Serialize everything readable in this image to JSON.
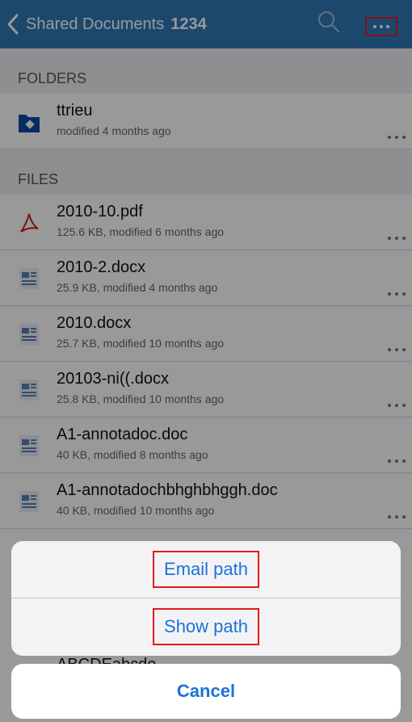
{
  "navbar": {
    "title": "Shared Documents",
    "title_number": "1234",
    "icons": [
      "chevron-left-icon",
      "search-icon",
      "more-icon"
    ]
  },
  "sections": {
    "folders_header": "FOLDERS",
    "files_header": "FILES"
  },
  "folders": [
    {
      "name": "ttrieu",
      "meta": "modified 4 months ago",
      "icon": "folder-icon"
    }
  ],
  "files": [
    {
      "name": "2010-10.pdf",
      "meta": "125.6 KB, modified 6 months ago",
      "icon": "pdf-icon"
    },
    {
      "name": "2010-2.docx",
      "meta": "25.9 KB, modified 4 months ago",
      "icon": "doc-icon"
    },
    {
      "name": "2010.docx",
      "meta": "25.7 KB, modified 10 months ago",
      "icon": "doc-icon"
    },
    {
      "name": "20103-ni((.docx",
      "meta": "25.8 KB, modified 10 months ago",
      "icon": "doc-icon"
    },
    {
      "name": "A1-annotadoc.doc",
      "meta": "40 KB, modified 8 months ago",
      "icon": "doc-icon"
    },
    {
      "name": "A1-annotadochbhghbhggh.doc",
      "meta": "40 KB, modified 10 months ago",
      "icon": "doc-icon"
    }
  ],
  "partial_file": {
    "name": "ABCDEabcde"
  },
  "action_sheet": {
    "email_path": "Email path",
    "show_path": "Show path",
    "cancel": "Cancel"
  },
  "colors": {
    "navbar": "#2f79b8",
    "accent": "#1a73d8",
    "highlight": "#e11b1b"
  }
}
